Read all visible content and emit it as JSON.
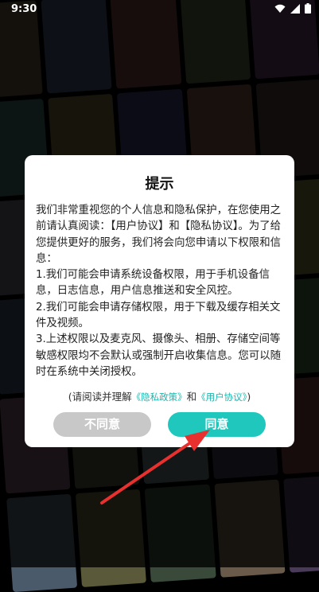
{
  "status_bar": {
    "time": "9:30"
  },
  "dialog": {
    "title": "提示",
    "paragraphs": [
      "我们非常重视您的个人信息和隐私保护，在您使用之前请认真阅读：【用户协议】和【隐私协议】。为了给您提供更好的服务，我们将会向您申请以下权限和信息：",
      "1.我们可能会申请系统设备权限，用于手机设备信息，日志信息，用户信息推送和安全风控。",
      "2.我们可能会申请存储权限，用于下载及缓存相关文件及视频。",
      "3.上述权限以及麦克风、摄像头、相册、存储空间等敏感权限均不会默认或强制开启收集信息。您可以随时在系统中关闭授权。"
    ],
    "consent": {
      "prefix": "(请阅读并理解",
      "privacy_link": "《隐私政策》",
      "and": "和",
      "user_link": "《用户协议》",
      "suffix": ")"
    },
    "disagree_label": "不同意",
    "agree_label": "同意"
  },
  "colors": {
    "accent": "#1fc7bd",
    "link": "#17b8b0",
    "disabled_button": "#c8c8c8",
    "arrow": "#e8302f"
  },
  "icons": [
    "wifi-icon",
    "signal-icon",
    "battery-icon"
  ]
}
